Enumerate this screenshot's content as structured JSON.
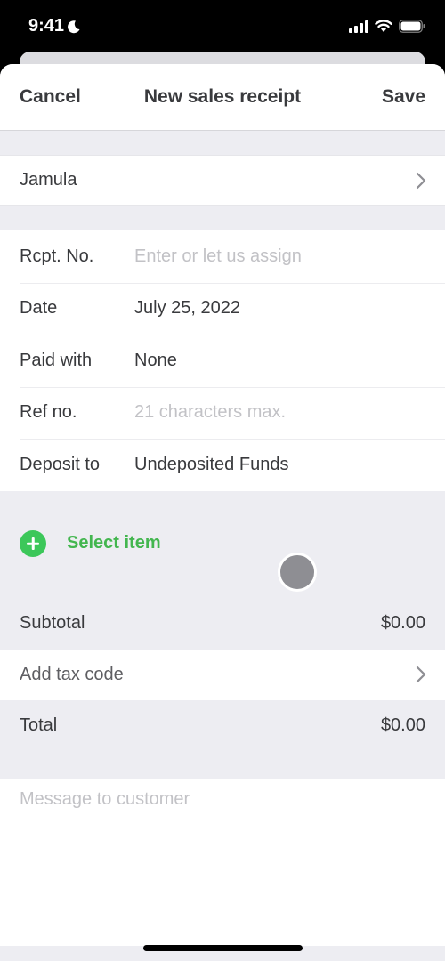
{
  "status_bar": {
    "time": "9:41",
    "icons": [
      "moon-icon",
      "signal-icon",
      "wifi-icon",
      "battery-icon"
    ]
  },
  "nav": {
    "cancel_label": "Cancel",
    "title": "New sales receipt",
    "save_label": "Save"
  },
  "customer": {
    "name": "Jamula"
  },
  "fields": [
    {
      "label": "Rcpt. No.",
      "value": "",
      "placeholder": "Enter or let us assign"
    },
    {
      "label": "Date",
      "value": "July 25, 2022",
      "placeholder": ""
    },
    {
      "label": "Paid with",
      "value": "None",
      "placeholder": ""
    },
    {
      "label": "Ref no.",
      "value": "",
      "placeholder": "21 characters max."
    },
    {
      "label": "Deposit to",
      "value": "Undeposited Funds",
      "placeholder": ""
    }
  ],
  "items": {
    "select_label": "Select item"
  },
  "summary": {
    "subtotal_label": "Subtotal",
    "subtotal_value": "$0.00",
    "tax_label": "Add tax code",
    "total_label": "Total",
    "total_value": "$0.00"
  },
  "message": {
    "placeholder": "Message to customer"
  },
  "colors": {
    "accent_green": "#43b64f",
    "plus_green": "#3cc75a",
    "text_dark": "#393a3d",
    "placeholder_gray": "#c2c2c6",
    "background_gray": "#ededf2"
  }
}
